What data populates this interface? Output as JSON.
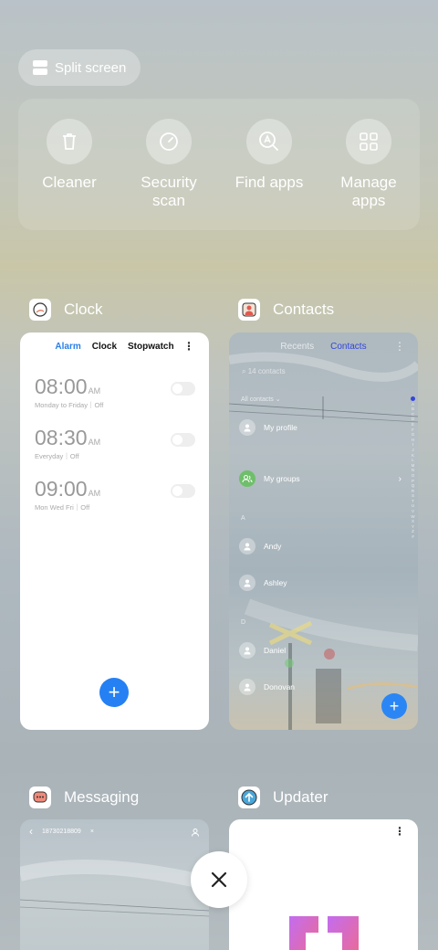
{
  "split_screen": {
    "label": "Split screen"
  },
  "tools": [
    {
      "label": "Cleaner",
      "icon": "trash-icon"
    },
    {
      "label": "Security\nscan",
      "icon": "security-scan-icon"
    },
    {
      "label": "Find apps",
      "icon": "find-apps-icon"
    },
    {
      "label": "Manage\napps",
      "icon": "manage-apps-icon"
    }
  ],
  "apps": {
    "clock": {
      "title": "Clock",
      "tabs": [
        "Alarm",
        "Clock",
        "Stopwatch"
      ],
      "more": "⋮",
      "alarms": [
        {
          "time": "08:00",
          "ampm": "AM",
          "sub": "Monday to Friday｜Off"
        },
        {
          "time": "08:30",
          "ampm": "AM",
          "sub": "Everyday｜Off"
        },
        {
          "time": "09:00",
          "ampm": "AM",
          "sub": "Mon Wed Fri｜Off"
        }
      ],
      "add": "+"
    },
    "contacts": {
      "title": "Contacts",
      "tabs": [
        "Recents",
        "Contacts"
      ],
      "more": "⋮",
      "search_placeholder": "14 contacts",
      "filter": "All contacts ⌄",
      "my_profile": "My profile",
      "my_groups": "My groups",
      "section_a": "A",
      "section_d": "D",
      "contacts": [
        "Andy",
        "Ashley",
        "Daniel",
        "Donovan"
      ],
      "alphabet": [
        "A",
        "B",
        "C",
        "D",
        "E",
        "F",
        "G",
        "H",
        "I",
        "J",
        "K",
        "L",
        "M",
        "N",
        "O",
        "P",
        "Q",
        "R",
        "S",
        "T",
        "U",
        "V",
        "W",
        "X",
        "Y",
        "Z",
        "#"
      ],
      "add": "+",
      "chevron": "›"
    },
    "messaging": {
      "title": "Messaging",
      "number": "18730218809",
      "clear": "×",
      "back": "‹"
    },
    "updater": {
      "title": "Updater",
      "more": "⋮"
    }
  },
  "colors": {
    "accent_blue": "#2580f3",
    "contacts_active": "#3346d8",
    "groups_green": "#6fbf6a"
  }
}
